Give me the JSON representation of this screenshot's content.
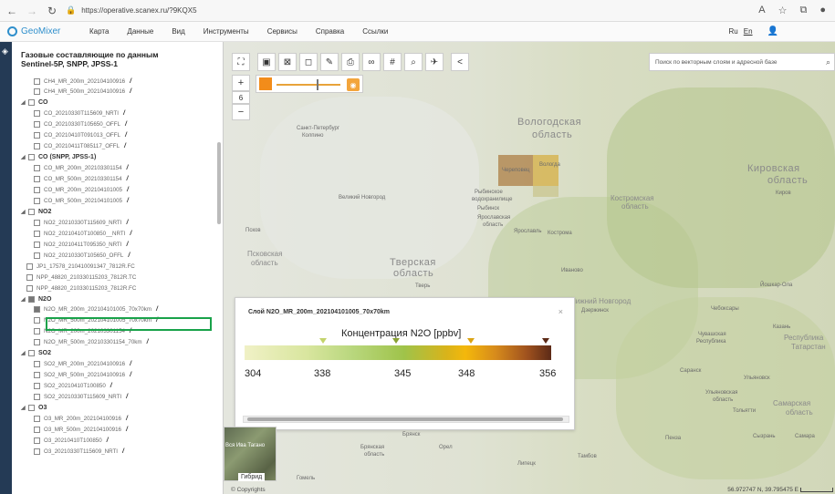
{
  "browser": {
    "url": "https://operative.scanex.ru/?9KQX5"
  },
  "app": {
    "logo": "GeoMixer",
    "menu": [
      "Карта",
      "Данные",
      "Вид",
      "Инструменты",
      "Сервисы",
      "Справка",
      "Ссылки"
    ],
    "lang_ru": "Ru",
    "lang_en": "En"
  },
  "sidebar": {
    "title_line1": "Газовые составляющие по данным",
    "title_line2": "Sentinel-5P, SNPP, JPSS-1",
    "rows": [
      {
        "label": "CH4_MR_200m_202104100916",
        "edit": "/"
      },
      {
        "label": "CH4_MR_500m_202104100916",
        "edit": "/"
      },
      {
        "label": "CO",
        "group": true
      },
      {
        "label": "CO_20210330T115609_NRTI",
        "edit": "/"
      },
      {
        "label": "CO_20210330T105650_OFFL",
        "edit": "/"
      },
      {
        "label": "CO_20210410T091013_OFFL",
        "edit": "/"
      },
      {
        "label": "CO_20210411T085117_OFFL",
        "edit": "/"
      },
      {
        "label": "CO (SNPP, JPSS-1)",
        "group": true
      },
      {
        "label": "CO_MR_200m_202103301154",
        "edit": "/"
      },
      {
        "label": "CO_MR_500m_202103301154",
        "edit": "/"
      },
      {
        "label": "CO_MR_200m_202104101005",
        "edit": "/"
      },
      {
        "label": "CO_MR_500m_202104101005",
        "edit": "/"
      },
      {
        "label": "NO2",
        "group": true
      },
      {
        "label": "NO2_20210330T115609_NRTI",
        "edit": "/"
      },
      {
        "label": "NO2_20210410T100850__NRTI",
        "edit": "/"
      },
      {
        "label": "NO2_20210411T095350_NRTI",
        "edit": "/"
      },
      {
        "label": "NO2_20210330T105650_OFFL",
        "edit": "/"
      },
      {
        "label": "JP1_17578_210410091347_7812R.FC",
        "edit": ""
      },
      {
        "label": "NPP_48820_210330115203_7812R.TC",
        "edit": ""
      },
      {
        "label": "NPP_48820_210330115203_7812R.FC",
        "edit": ""
      },
      {
        "label": "N2O",
        "group": true,
        "checked": true
      },
      {
        "label": "N2O_MR_200m_202104101005_70x70km",
        "edit": "/",
        "checked": true
      },
      {
        "label": "N2O_MR_500m_202104101005_70x70km",
        "edit": "/"
      },
      {
        "label": "N2O_MR_200m_202103301154",
        "edit": "/"
      },
      {
        "label": "N2O_MR_500m_202103301154_70km",
        "edit": "/"
      },
      {
        "label": "SO2",
        "group": true
      },
      {
        "label": "SO2_MR_200m_202104100916",
        "edit": "/"
      },
      {
        "label": "SO2_MR_500m_202104100916",
        "edit": "/"
      },
      {
        "label": "SO2_20210410T100850",
        "edit": "/"
      },
      {
        "label": "SO2_20210330T115609_NRTI",
        "edit": "/"
      },
      {
        "label": "O3",
        "group": true
      },
      {
        "label": "O3_MR_200m_202104100916",
        "edit": "/"
      },
      {
        "label": "O3_MR_500m_202104100916",
        "edit": "/"
      },
      {
        "label": "O3_20210410T100850",
        "edit": "/"
      },
      {
        "label": "O3_20210330T115609_NRTI",
        "edit": "/"
      }
    ]
  },
  "map": {
    "search_placeholder": "Поиск по векторным слоям и адресной базе",
    "zoom_level": "6",
    "places": [
      "Вологодская",
      "область",
      "Вологда",
      "Череповец",
      "Санкт-Петербург",
      "Колпино",
      "Великий Новгород",
      "Рыбинское",
      "водохранилище",
      "Рыбинск",
      "Ярославская",
      "область",
      "Ярославль",
      "Кострома",
      "Костромская",
      "область",
      "Кировская",
      "область",
      "Киров",
      "Псков",
      "Псковская",
      "область",
      "Тверская",
      "область",
      "Тверь",
      "Иваново",
      "Нижний Новгород",
      "Дзержинск",
      "Йошкар-Ола",
      "Чебоксары",
      "Казань",
      "Чувашская",
      "Республика",
      "Республика",
      "Татарстан",
      "Ульяновск",
      "Саранск",
      "Ульяновская",
      "область",
      "Самарская",
      "область",
      "Тольятти",
      "Сызрань",
      "Самара",
      "Пенза",
      "Брянск",
      "Брянская",
      "область",
      "Орел",
      "Липецк",
      "Тамбов",
      "Гомель",
      "Вся Ива"
    ],
    "legend_title": "Слой N2O_MR_200m_202104101005_70x70km",
    "legend_heading": "Концентрация N2O  [ppbv]",
    "legend_ticks": [
      "304",
      "338",
      "345",
      "348",
      "356"
    ],
    "basemap_label": "Гибрид",
    "basemap_mini": "Вся Ива  Тагано",
    "copyright": "© Copyrights",
    "coords": "56.972747 N, 39.795475 E",
    "scale": "100"
  },
  "colors": {
    "accent": "#2f8fcc",
    "highlight": "#19a24a",
    "strip": "#243a55"
  }
}
